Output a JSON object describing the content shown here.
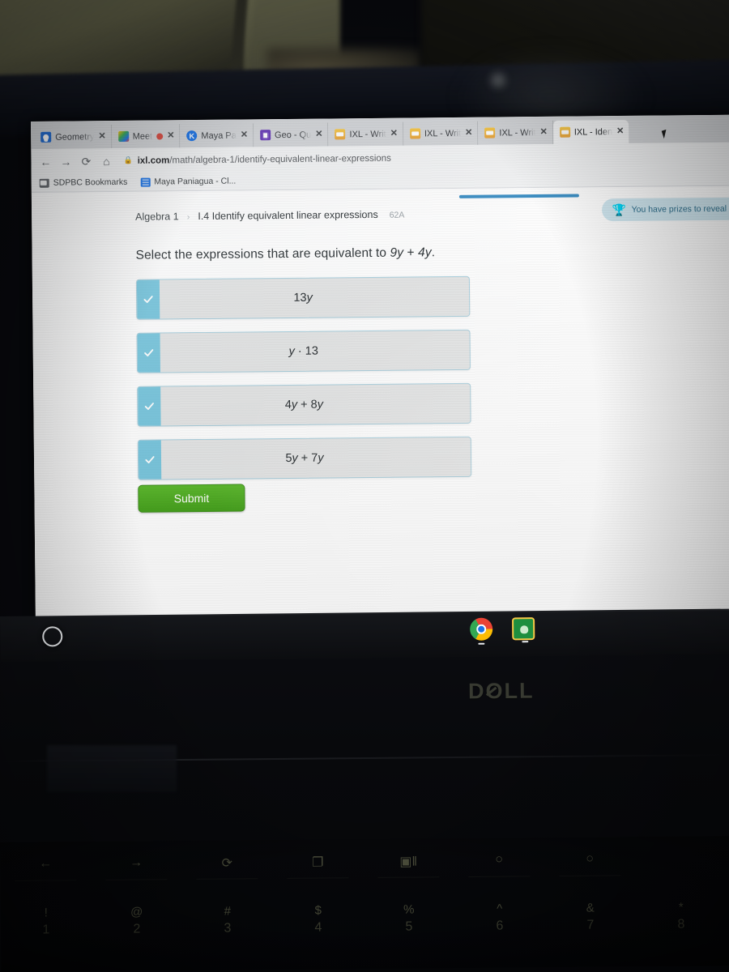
{
  "browser": {
    "tabs": [
      {
        "title": "Geometry",
        "favicon": "classroom-icon",
        "active": false,
        "recording": false
      },
      {
        "title": "Meet",
        "favicon": "google-meet-icon",
        "active": false,
        "recording": true
      },
      {
        "title": "Maya Pa",
        "favicon": "kami-icon",
        "active": false,
        "recording": false
      },
      {
        "title": "Geo - Qu",
        "favicon": "google-forms-icon",
        "active": false,
        "recording": false
      },
      {
        "title": "IXL - Writ",
        "favicon": "ixl-icon",
        "active": false,
        "recording": false
      },
      {
        "title": "IXL - Writ",
        "favicon": "ixl-icon",
        "active": false,
        "recording": false
      },
      {
        "title": "IXL - Writ",
        "favicon": "ixl-icon",
        "active": false,
        "recording": false
      },
      {
        "title": "IXL - Iden",
        "favicon": "ixl-icon",
        "active": true,
        "recording": false
      }
    ],
    "close_label": "✕",
    "nav": {
      "back": "←",
      "forward": "→",
      "reload": "⟳",
      "home": "⌂"
    },
    "omnibox": {
      "lock": "🔒",
      "host": "ixl.com",
      "path": "/math/algebra-1/identify-equivalent-linear-expressions"
    },
    "bookmarks": [
      {
        "label": "SDPBC Bookmarks",
        "icon": "folder-icon"
      },
      {
        "label": "Maya Paniagua - Cl...",
        "icon": "document-icon"
      }
    ]
  },
  "page": {
    "breadcrumb": {
      "course": "Algebra 1",
      "separator": "›",
      "skill": "I.4 Identify equivalent linear expressions",
      "code": "62A"
    },
    "prize_banner": {
      "icon": "trophy-icon",
      "text": "You have prizes to reveal"
    },
    "progress_percent": 51,
    "question": {
      "prefix": "Select the expressions that are equivalent to ",
      "expr_a": "9y",
      "operator": " + ",
      "expr_b": "4y",
      "suffix": "."
    },
    "options": [
      {
        "text": "13y",
        "checked": true,
        "check_icon": "checkmark-icon"
      },
      {
        "text": "y · 13",
        "checked": true,
        "check_icon": "checkmark-icon"
      },
      {
        "text": "4y + 8y",
        "checked": true,
        "check_icon": "checkmark-icon"
      },
      {
        "text": "5y + 7y",
        "checked": true,
        "check_icon": "checkmark-icon"
      }
    ],
    "submit_label": "Submit"
  },
  "shelf": {
    "launcher": "launcher-icon",
    "apps": [
      {
        "name": "chrome-icon",
        "running": true
      },
      {
        "name": "google-classroom-icon",
        "running": true
      }
    ]
  },
  "hardware": {
    "brand": "DELL",
    "brand_parts": {
      "d": "D",
      "o": "Ø",
      "ll": "LL"
    },
    "function_keys": [
      "←",
      "→",
      "⟳",
      "❐",
      "▣‖",
      "○",
      "○"
    ],
    "number_keys": [
      {
        "symbol": "!",
        "number": "1"
      },
      {
        "symbol": "@",
        "number": "2"
      },
      {
        "symbol": "#",
        "number": "3"
      },
      {
        "symbol": "$",
        "number": "4"
      },
      {
        "symbol": "%",
        "number": "5"
      },
      {
        "symbol": "^",
        "number": "6"
      },
      {
        "symbol": "&",
        "number": "7"
      },
      {
        "symbol": "*",
        "number": "8"
      }
    ]
  },
  "colors": {
    "accent_blue": "#3d8fc4",
    "option_check": "#79c6dd",
    "submit_green": "#4caf24",
    "banner_blue": "#cfe6ef"
  }
}
